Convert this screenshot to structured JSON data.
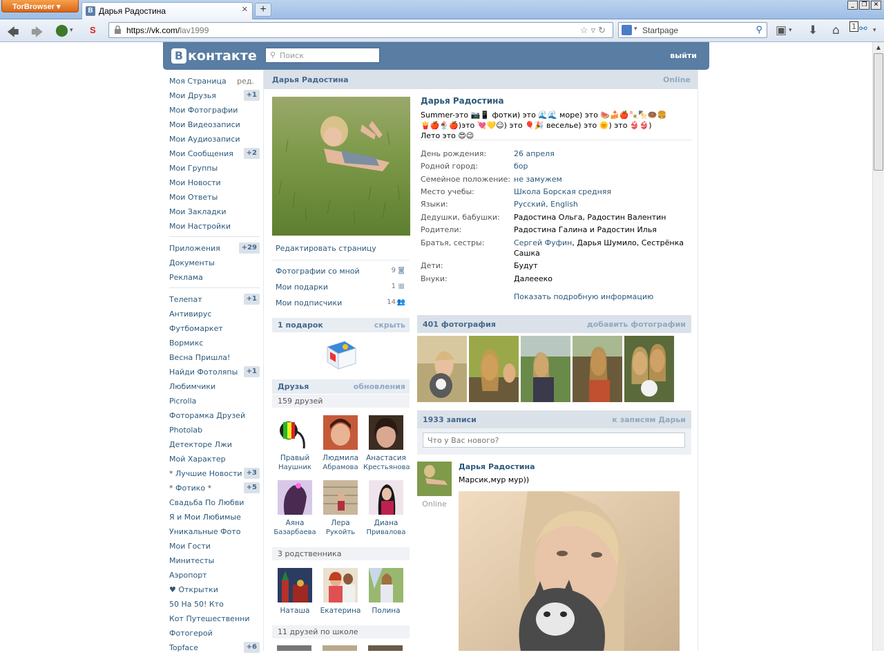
{
  "browser": {
    "tor_button": "TorBrowser",
    "tab_title": "Дарья Радостина",
    "tab_favicon": "B",
    "url_host": "https://vk.com/",
    "url_path": "lav1999",
    "search_placeholder": "Startpage",
    "tab_count": "1"
  },
  "vk": {
    "logo_text": "контакте",
    "logo_letter": "В",
    "search_placeholder": "Поиск",
    "logout": "выйти"
  },
  "nav": {
    "items": [
      {
        "label": "Моя Страница",
        "extra": "ред."
      },
      {
        "label": "Мои Друзья",
        "badge": "+1"
      },
      {
        "label": "Мои Фотографии"
      },
      {
        "label": "Мои Видеозаписи"
      },
      {
        "label": "Мои Аудиозаписи"
      },
      {
        "label": "Мои Сообщения",
        "badge": "+2"
      },
      {
        "label": "Мои Группы"
      },
      {
        "label": "Мои Новости"
      },
      {
        "label": "Мои Ответы"
      },
      {
        "label": "Мои Закладки"
      },
      {
        "label": "Мои Настройки"
      }
    ],
    "services": [
      {
        "label": "Приложения",
        "badge": "+29"
      },
      {
        "label": "Документы"
      },
      {
        "label": "Реклама"
      }
    ],
    "apps": [
      {
        "label": "Телепат",
        "badge": "+1"
      },
      {
        "label": "Антивирус"
      },
      {
        "label": "Футбомаркет"
      },
      {
        "label": "Вормикс"
      },
      {
        "label": "Весна Пришла!"
      },
      {
        "label": "Найди Фотоляпы",
        "badge": "+1"
      },
      {
        "label": "Любимчики"
      },
      {
        "label": "Picrolla"
      },
      {
        "label": "Фоторамка Друзей"
      },
      {
        "label": "Photolab"
      },
      {
        "label": "Детекторе Лжи"
      },
      {
        "label": "Мой Характер"
      },
      {
        "label": "* Лучшие Новости",
        "badge": "+3"
      },
      {
        "label": "* Фотико *",
        "badge": "+5"
      },
      {
        "label": "Свадьба По Любви"
      },
      {
        "label": "Я и Мои Любимые"
      },
      {
        "label": "Уникальные Фото"
      },
      {
        "label": "Мои Гости"
      },
      {
        "label": "Минитесты"
      },
      {
        "label": "Аэропорт"
      },
      {
        "label": "♥ Открытки"
      },
      {
        "label": "50 На 50! Кто"
      },
      {
        "label": "Кот Путешественни"
      },
      {
        "label": "Фотогерой"
      },
      {
        "label": "Topface",
        "badge": "+6"
      }
    ]
  },
  "profile": {
    "header_name": "Дарья Радостина",
    "online": "Online",
    "name": "Дарья Радостина",
    "status_line1": "Summer-это 📷📱 фотки) это 🌊🌊 море) это 🍉🍰🍎🍡🍢🍩🍔",
    "status_line2": "🍟🍎🍨🍎)это 💘💛☺) это 🎈🎉 веселье) это 🌞) это 👙👙)",
    "status_line3": "Лето это 😍😉",
    "edit_page": "Редактировать страницу",
    "links": [
      {
        "label": "Фотографии со мной",
        "count": "9"
      },
      {
        "label": "Мои подарки",
        "count": "1"
      },
      {
        "label": "Мои подписчики",
        "count": "14"
      }
    ],
    "info": [
      {
        "key": "День рождения:",
        "value": "26 апреля",
        "link": true
      },
      {
        "key": "Родной город:",
        "value": "бор",
        "link": true
      },
      {
        "key": "Семейное положение:",
        "value": "не замужем",
        "link": true
      },
      {
        "key": "Место учебы:",
        "value": "Школа Борская средняя",
        "link": true
      },
      {
        "key": "Языки:",
        "value": "Русский, English",
        "link": true
      },
      {
        "key": "Дедушки, бабушки:",
        "value": "Радостина Ольга, Радостин Валентин",
        "link": false
      },
      {
        "key": "Родители:",
        "value": "Радостина Галина и Радостин Илья",
        "link": false
      },
      {
        "key": "Братья, сестры:",
        "value_link": "Сергей Фуфин",
        "value_rest": ", Дарья Шумило, Сестрёнка Сашка"
      },
      {
        "key": "Дети:",
        "value": "Будут",
        "link": false
      },
      {
        "key": "Внуки:",
        "value": "Далееeко",
        "link": false
      }
    ],
    "show_more": "Показать подробную информацию"
  },
  "gifts": {
    "title": "1 подарок",
    "action": "скрыть"
  },
  "friends": {
    "title": "Друзья",
    "action": "обновления",
    "count": "159 друзей",
    "list": [
      {
        "first": "Правый",
        "last": "Наушник"
      },
      {
        "first": "Людмила",
        "last": "Абрамова"
      },
      {
        "first": "Анастасия",
        "last": "Крестьянова"
      },
      {
        "first": "Аяна",
        "last": "Базарбаева"
      },
      {
        "first": "Лера",
        "last": "Рукойть"
      },
      {
        "first": "Диана",
        "last": "Привалова"
      }
    ],
    "relatives_count": "3 родственника",
    "relatives": [
      {
        "first": "Наташа"
      },
      {
        "first": "Екатерина"
      },
      {
        "first": "Полина"
      }
    ],
    "school_count": "11 друзей по школе"
  },
  "photos": {
    "title": "401 фотография",
    "action": "добавить фотографии"
  },
  "wall": {
    "title": "1933 записи",
    "action": "к записям Дарьи",
    "input_placeholder": "Что у Вас нового?",
    "post_author": "Дарья Радостина",
    "post_text": "Марсик,мур мур))",
    "author_online": "Online"
  },
  "colors": {
    "vk_header": "#597da3",
    "link": "#2b587a",
    "header_bg": "#dae1e8",
    "muted_head": "#8fa9c2"
  }
}
